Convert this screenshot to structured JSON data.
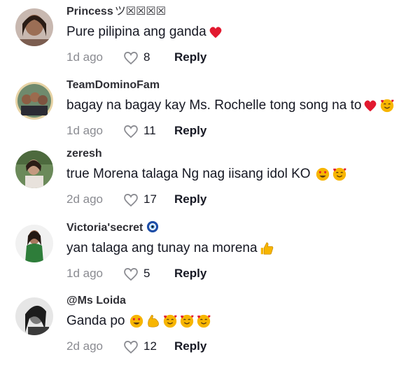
{
  "comments": [
    {
      "username": "Princess",
      "badge": "ツ☒☒☒☒",
      "text": "Pure pilipina ang ganda",
      "emojis": [
        "heart"
      ],
      "time": "1d ago",
      "likes": "8",
      "reply": "Reply"
    },
    {
      "username": "TeamDominoFam",
      "badge": "",
      "text": "bagay na bagay kay Ms. Rochelle tong song na to",
      "emojis": [
        "heart",
        "smiling-hearts"
      ],
      "time": "1d ago",
      "likes": "11",
      "reply": "Reply"
    },
    {
      "username": "zeresh",
      "badge": "",
      "text": "true Morena talaga Ng nag iisang idol KO",
      "emojis": [
        "heart-eyes",
        "smiling-hearts"
      ],
      "time": "2d ago",
      "likes": "17",
      "reply": "Reply"
    },
    {
      "username": "Victoria'secret",
      "badge": "🧿",
      "text": "yan talaga ang tunay na morena",
      "emojis": [
        "thumbs-up"
      ],
      "time": "1d ago",
      "likes": "5",
      "reply": "Reply"
    },
    {
      "username": "@Ms Loida",
      "badge": "",
      "text": "Ganda po",
      "emojis": [
        "heart-eyes",
        "flexed-arm",
        "smiling-hearts",
        "smiling-hearts",
        "smiling-hearts"
      ],
      "time": "2d ago",
      "likes": "12",
      "reply": "Reply"
    }
  ],
  "colors": {
    "username": "#2f2f35",
    "text": "#161823",
    "meta": "#8a8b91",
    "heart": "#e2192f",
    "emoji": "#f7b500"
  }
}
